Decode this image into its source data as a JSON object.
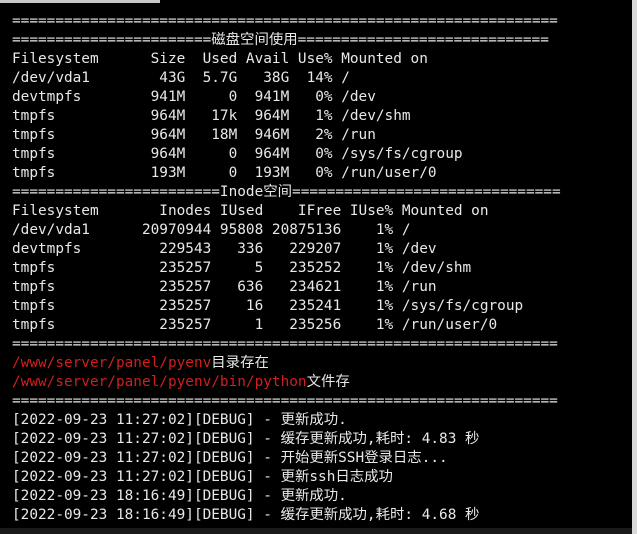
{
  "terminal": {
    "lines": [
      "===============================================================",
      "=======================磁盘空间使用=============================",
      "Filesystem      Size  Used Avail Use% Mounted on",
      "/dev/vda1        43G  5.7G   38G  14% /",
      "devtmpfs        941M     0  941M   0% /dev",
      "tmpfs           964M   17k  964M   1% /dev/shm",
      "tmpfs           964M   18M  946M   2% /run",
      "tmpfs           964M     0  964M   0% /sys/fs/cgroup",
      "tmpfs           193M     0  193M   0% /run/user/0",
      "========================Inode空间===============================",
      "Filesystem       Inodes IUsed    IFree IUse% Mounted on",
      "/dev/vda1      20970944 95808 20875136    1% /",
      "devtmpfs         229543   336   229207    1% /dev",
      "tmpfs            235257     5   235252    1% /dev/shm",
      "tmpfs            235257   636   234621    1% /run",
      "tmpfs            235257    16   235241    1% /sys/fs/cgroup",
      "tmpfs            235257     1   235256    1% /run/user/0",
      "==============================================================="
    ],
    "path_checks": [
      {
        "path": "/www/server/panel/pyenv",
        "message": "目录存在"
      },
      {
        "path": "/www/server/panel/pyenv/bin/python",
        "message": "文件存"
      }
    ],
    "separator_after_checks": "===============================================================",
    "logs": [
      "[2022-09-23 11:27:02][DEBUG] - 更新成功.",
      "[2022-09-23 11:27:02][DEBUG] - 缓存更新成功,耗时: 4.83 秒",
      "[2022-09-23 11:27:02][DEBUG] - 开始更新SSH登录日志...",
      "[2022-09-23 11:27:02][DEBUG] - 更新ssh日志成功",
      "[2022-09-23 18:16:49][DEBUG] - 更新成功.",
      "[2022-09-23 18:16:49][DEBUG] - 缓存更新成功,耗时: 4.68 秒"
    ]
  },
  "colors": {
    "background": "#000000",
    "text": "#e8e8e8",
    "path_highlight": "#d11f1f"
  }
}
